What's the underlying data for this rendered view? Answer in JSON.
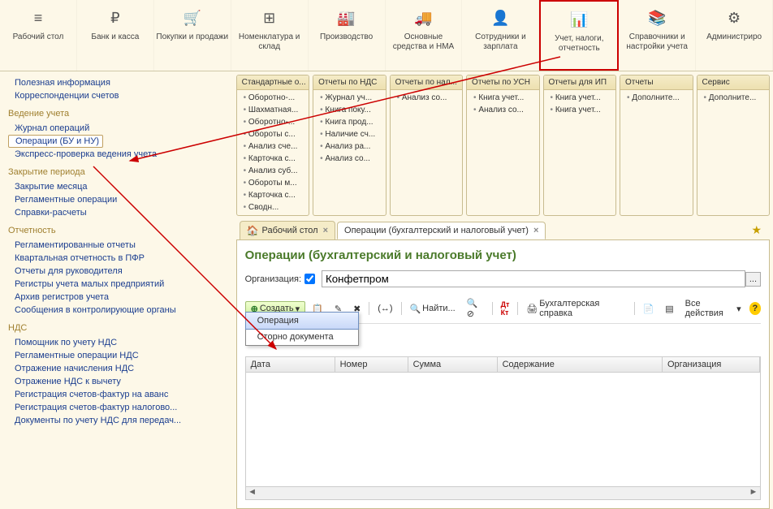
{
  "nav": [
    {
      "icon": "≡",
      "label": "Рабочий стол"
    },
    {
      "icon": "₽",
      "label": "Банк и касса"
    },
    {
      "icon": "🛒",
      "label": "Покупки и продажи"
    },
    {
      "icon": "⊞",
      "label": "Номенклатура и склад"
    },
    {
      "icon": "🏭",
      "label": "Производство"
    },
    {
      "icon": "🚚",
      "label": "Основные средства и НМА"
    },
    {
      "icon": "👤",
      "label": "Сотрудники и зарплата"
    },
    {
      "icon": "📊",
      "label": "Учет, налоги, отчетность"
    },
    {
      "icon": "📚",
      "label": "Справочники и настройки учета"
    },
    {
      "icon": "⚙",
      "label": "Администриро"
    }
  ],
  "sidebar": {
    "sec0": {
      "title": "",
      "items": [
        "Полезная информация",
        "Корреспонденции счетов"
      ]
    },
    "sec1": {
      "title": "Ведение учета",
      "items": [
        "Журнал операций",
        "Операции (БУ и НУ)",
        "Экспресс-проверка ведения учета"
      ],
      "selected": 1
    },
    "sec2": {
      "title": "Закрытие периода",
      "items": [
        "Закрытие месяца",
        "Регламентные операции",
        "Справки-расчеты"
      ]
    },
    "sec3": {
      "title": "Отчетность",
      "items": [
        "Регламентированные отчеты",
        "Квартальная отчетность в ПФР",
        "Отчеты для руководителя",
        "Регистры учета малых предприятий",
        "Архив регистров учета",
        "Сообщения в контролирующие органы"
      ]
    },
    "sec4": {
      "title": "НДС",
      "items": [
        "Помощник по учету НДС",
        "Регламентные операции НДС",
        "Отражение начисления НДС",
        "Отражение НДС к вычету",
        "Регистрация счетов-фактур на аванс",
        "Регистрация счетов-фактур налогово...",
        "Документы по учету НДС для передач..."
      ]
    }
  },
  "panels": [
    {
      "title": "Стандартные о...",
      "items": [
        "Оборотно-...",
        "Шахматная...",
        "Оборотно-...",
        "Обороты с...",
        "Анализ сче...",
        "Карточка с...",
        "Анализ суб...",
        "Обороты м...",
        "Карточка с...",
        "Сводн..."
      ]
    },
    {
      "title": "Отчеты по НДС",
      "items": [
        "Журнал уч...",
        "Книга поку...",
        "Книга прод...",
        "Наличие сч...",
        "Анализ ра...",
        "Анализ со..."
      ]
    },
    {
      "title": "Отчеты по нал...",
      "items": [
        "Анализ со..."
      ]
    },
    {
      "title": "Отчеты по УСН",
      "items": [
        "Книга учет...",
        "Анализ со..."
      ]
    },
    {
      "title": "Отчеты для ИП",
      "items": [
        "Книга учет...",
        "Книга учет..."
      ]
    },
    {
      "title": "Отчеты",
      "items": [
        "Дополните..."
      ]
    },
    {
      "title": "Сервис",
      "items": [
        "Дополните..."
      ]
    }
  ],
  "tabs": [
    {
      "label": "Рабочий стол",
      "icon": "🏠"
    },
    {
      "label": "Операции (бухгалтерский и налоговый учет)",
      "active": true
    }
  ],
  "content": {
    "title": "Операции (бухгалтерский и налоговый учет)",
    "org_label": "Организация:",
    "org_value": "Конфетпром",
    "toolbar": {
      "create": "Создать",
      "find": "Найти...",
      "print": "Бухгалтерская справка",
      "all_actions": "Все действия"
    },
    "dropdown": [
      "Операция",
      "Сторно документа"
    ],
    "columns": [
      "Дата",
      "Номер",
      "Сумма",
      "Содержание",
      "Организация"
    ]
  }
}
